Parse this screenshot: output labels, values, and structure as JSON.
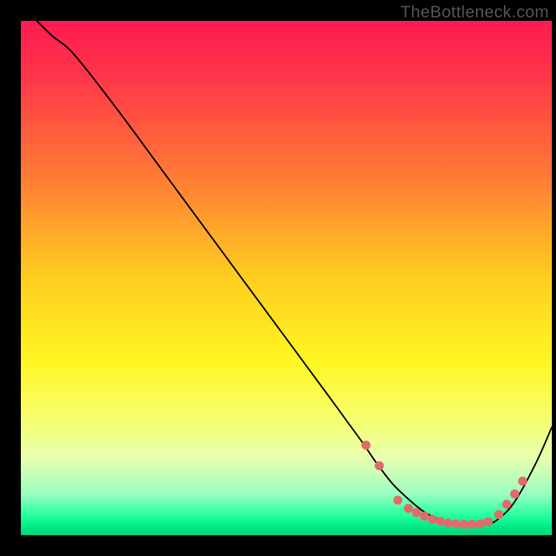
{
  "watermark": "TheBottleneck.com",
  "chart_data": {
    "type": "line",
    "title": "",
    "xlabel": "",
    "ylabel": "",
    "xlim": [
      0,
      100
    ],
    "ylim": [
      0,
      100
    ],
    "background_gradient": {
      "stops": [
        {
          "offset": 0.0,
          "color": "#ff1a52"
        },
        {
          "offset": 0.12,
          "color": "#ff3a48"
        },
        {
          "offset": 0.3,
          "color": "#ff7a35"
        },
        {
          "offset": 0.5,
          "color": "#ffce1f"
        },
        {
          "offset": 0.66,
          "color": "#fff622"
        },
        {
          "offset": 0.78,
          "color": "#f6ff73"
        },
        {
          "offset": 0.85,
          "color": "#e8ffb0"
        },
        {
          "offset": 0.92,
          "color": "#9affc0"
        },
        {
          "offset": 0.965,
          "color": "#1cff9a"
        },
        {
          "offset": 0.985,
          "color": "#00e884"
        },
        {
          "offset": 1.0,
          "color": "#00d878"
        }
      ]
    },
    "series": [
      {
        "name": "bottleneck-curve",
        "x": [
          3,
          6,
          10,
          18,
          28,
          38,
          48,
          58,
          64,
          67,
          70,
          73,
          76,
          79,
          82,
          85,
          88,
          90,
          93,
          97,
          100
        ],
        "y": [
          100,
          97,
          93.5,
          83,
          69,
          55,
          41,
          27,
          18.5,
          14,
          10,
          7,
          4.5,
          3,
          2.2,
          2,
          2.2,
          3.2,
          6.5,
          14,
          21
        ]
      }
    ],
    "markers": {
      "name": "highlight-points",
      "color": "#e26a6a",
      "points": [
        {
          "x": 65,
          "y": 17.5
        },
        {
          "x": 67.5,
          "y": 13.5
        },
        {
          "x": 71,
          "y": 6.8
        },
        {
          "x": 73,
          "y": 5.2
        },
        {
          "x": 74.5,
          "y": 4.4
        },
        {
          "x": 76,
          "y": 3.7
        },
        {
          "x": 77.5,
          "y": 3.1
        },
        {
          "x": 79,
          "y": 2.7
        },
        {
          "x": 80.5,
          "y": 2.4
        },
        {
          "x": 82,
          "y": 2.2
        },
        {
          "x": 83.5,
          "y": 2.1
        },
        {
          "x": 85,
          "y": 2.1
        },
        {
          "x": 86.5,
          "y": 2.2
        },
        {
          "x": 88,
          "y": 2.6
        },
        {
          "x": 90,
          "y": 4.0
        },
        {
          "x": 91.5,
          "y": 6.0
        },
        {
          "x": 93,
          "y": 8.0
        },
        {
          "x": 94.5,
          "y": 10.5
        }
      ]
    }
  }
}
